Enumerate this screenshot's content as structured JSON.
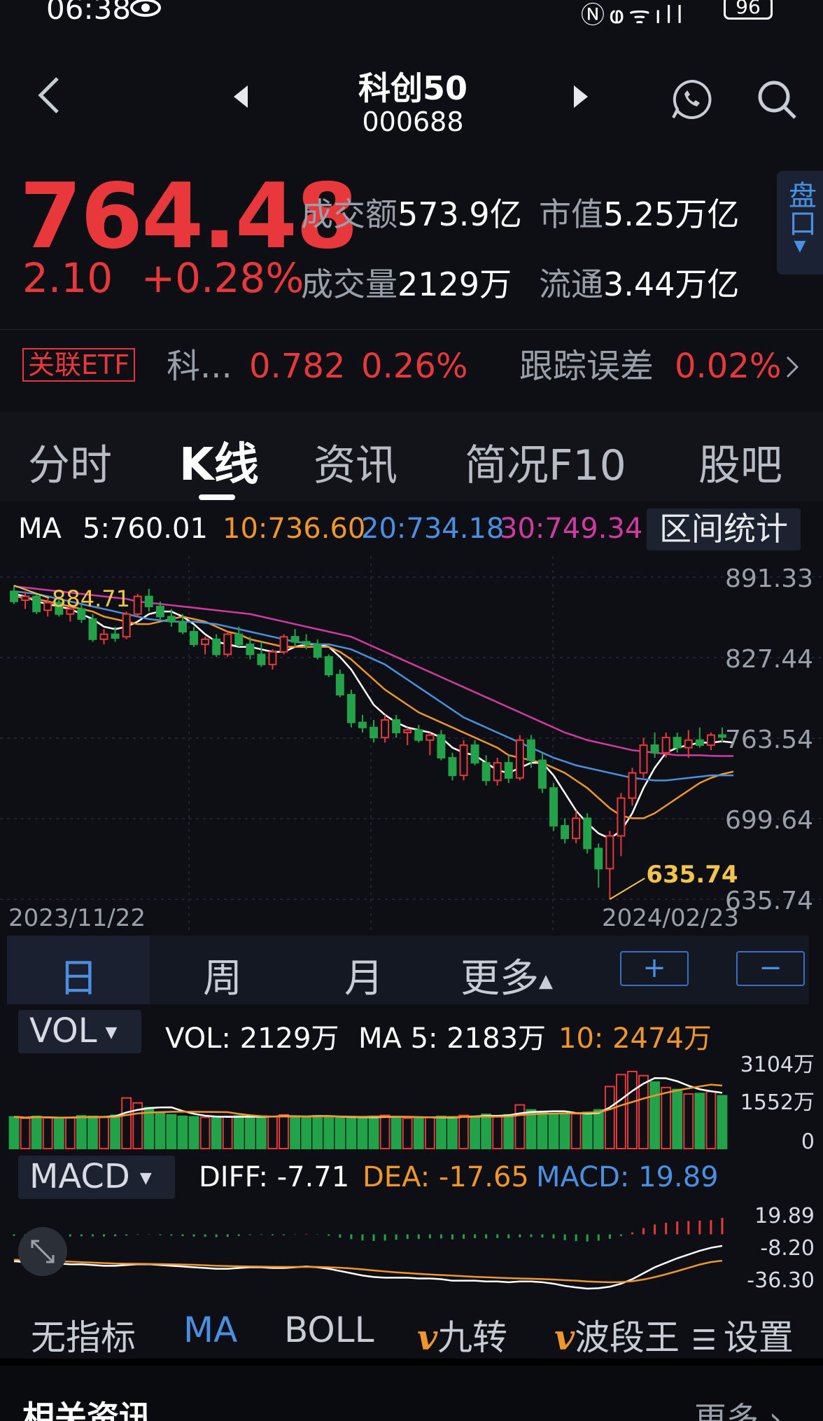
{
  "status_bar": {
    "time": "06:38",
    "battery": "96"
  },
  "header": {
    "name": "科创50",
    "code": "000688"
  },
  "quote": {
    "price": "764.48",
    "change": "2.10",
    "change_pct": "+0.28%",
    "turnover_label": "成交额",
    "turnover_value": "573.9亿",
    "market_cap_label": "市值",
    "market_cap_value": "5.25万亿",
    "volume_label": "成交量",
    "volume_value": "2129万",
    "float_label": "流通",
    "float_value": "3.44万亿",
    "panel_tab": "盘口"
  },
  "etf": {
    "badge": "关联ETF",
    "name": "科...",
    "price": "0.782",
    "pct": "0.26%",
    "tracking_label": "跟踪误差",
    "tracking_value": "0.02%"
  },
  "tabs": [
    "分时",
    "K线",
    "资讯",
    "简况F10",
    "股吧"
  ],
  "active_tab": "K线",
  "ma_header": {
    "label": "MA",
    "ma5": "5:760.01",
    "ma10": "10:736.60",
    "ma20": "20:734.18",
    "ma30": "30:749.34",
    "range_button": "区间统计"
  },
  "kline": {
    "y_ticks": [
      "891.33",
      "827.44",
      "763.54",
      "699.64",
      "635.74"
    ],
    "start_date": "2023/11/22",
    "end_date": "2024/02/23",
    "high_mark": "884.71",
    "low_mark": "635.74"
  },
  "periods": [
    "日",
    "周",
    "月",
    "更多"
  ],
  "zoom": {
    "plus": "+",
    "minus": "−"
  },
  "vol_header": {
    "selector": "VOL",
    "vol": "VOL: 2129万",
    "ma5": "MA 5: 2183万",
    "ma10": "10: 2474万",
    "y_ticks": [
      "3104万",
      "1552万",
      "0"
    ]
  },
  "macd_header": {
    "selector": "MACD",
    "diff": "DIFF: -7.71",
    "dea": "DEA: -17.65",
    "macd": "MACD: 19.89",
    "y_ticks": [
      "19.89",
      "-8.20",
      "-36.30"
    ]
  },
  "indicators": [
    "无指标",
    "MA",
    "BOLL",
    "九转",
    "波段王",
    "设置"
  ],
  "active_indicator": "MA",
  "news": {
    "title": "相关资讯",
    "more": "更多"
  },
  "colors": {
    "up": "#e8383b",
    "down": "#22a34a",
    "ma5": "#ffffff",
    "ma10": "#f0962b",
    "ma20": "#4a90e2",
    "ma30": "#d23aa1",
    "accent": "#4a90e2"
  },
  "chart_data": {
    "type": "candlestick",
    "candles": [
      {
        "o": 880,
        "h": 884.71,
        "l": 870,
        "c": 872
      },
      {
        "o": 873,
        "h": 880,
        "l": 866,
        "c": 876
      },
      {
        "o": 876,
        "h": 878,
        "l": 862,
        "c": 864
      },
      {
        "o": 865,
        "h": 874,
        "l": 860,
        "c": 871
      },
      {
        "o": 871,
        "h": 876,
        "l": 860,
        "c": 862
      },
      {
        "o": 862,
        "h": 868,
        "l": 856,
        "c": 866
      },
      {
        "o": 866,
        "h": 870,
        "l": 855,
        "c": 858
      },
      {
        "o": 858,
        "h": 862,
        "l": 840,
        "c": 842
      },
      {
        "o": 842,
        "h": 850,
        "l": 838,
        "c": 846
      },
      {
        "o": 846,
        "h": 852,
        "l": 840,
        "c": 843
      },
      {
        "o": 844,
        "h": 864,
        "l": 842,
        "c": 862
      },
      {
        "o": 862,
        "h": 878,
        "l": 860,
        "c": 876
      },
      {
        "o": 876,
        "h": 882,
        "l": 864,
        "c": 868
      },
      {
        "o": 868,
        "h": 872,
        "l": 858,
        "c": 860
      },
      {
        "o": 860,
        "h": 866,
        "l": 852,
        "c": 856
      },
      {
        "o": 856,
        "h": 862,
        "l": 846,
        "c": 848
      },
      {
        "o": 848,
        "h": 852,
        "l": 836,
        "c": 838
      },
      {
        "o": 838,
        "h": 844,
        "l": 830,
        "c": 842
      },
      {
        "o": 842,
        "h": 846,
        "l": 828,
        "c": 830
      },
      {
        "o": 830,
        "h": 848,
        "l": 828,
        "c": 846
      },
      {
        "o": 846,
        "h": 852,
        "l": 836,
        "c": 838
      },
      {
        "o": 838,
        "h": 844,
        "l": 826,
        "c": 830
      },
      {
        "o": 830,
        "h": 840,
        "l": 820,
        "c": 822
      },
      {
        "o": 822,
        "h": 834,
        "l": 818,
        "c": 832
      },
      {
        "o": 832,
        "h": 846,
        "l": 830,
        "c": 844
      },
      {
        "o": 844,
        "h": 850,
        "l": 836,
        "c": 840
      },
      {
        "o": 840,
        "h": 846,
        "l": 834,
        "c": 838
      },
      {
        "o": 838,
        "h": 842,
        "l": 826,
        "c": 828
      },
      {
        "o": 828,
        "h": 830,
        "l": 812,
        "c": 814
      },
      {
        "o": 814,
        "h": 818,
        "l": 796,
        "c": 798
      },
      {
        "o": 798,
        "h": 802,
        "l": 772,
        "c": 776
      },
      {
        "o": 776,
        "h": 782,
        "l": 768,
        "c": 772
      },
      {
        "o": 772,
        "h": 778,
        "l": 760,
        "c": 764
      },
      {
        "o": 764,
        "h": 782,
        "l": 760,
        "c": 778
      },
      {
        "o": 778,
        "h": 782,
        "l": 764,
        "c": 768
      },
      {
        "o": 768,
        "h": 772,
        "l": 758,
        "c": 770
      },
      {
        "o": 770,
        "h": 774,
        "l": 760,
        "c": 762
      },
      {
        "o": 762,
        "h": 768,
        "l": 750,
        "c": 766
      },
      {
        "o": 766,
        "h": 770,
        "l": 746,
        "c": 748
      },
      {
        "o": 748,
        "h": 752,
        "l": 730,
        "c": 734
      },
      {
        "o": 734,
        "h": 762,
        "l": 730,
        "c": 758
      },
      {
        "o": 758,
        "h": 762,
        "l": 742,
        "c": 744
      },
      {
        "o": 744,
        "h": 750,
        "l": 726,
        "c": 730
      },
      {
        "o": 730,
        "h": 748,
        "l": 726,
        "c": 744
      },
      {
        "o": 744,
        "h": 750,
        "l": 728,
        "c": 732
      },
      {
        "o": 732,
        "h": 766,
        "l": 730,
        "c": 762
      },
      {
        "o": 762,
        "h": 766,
        "l": 740,
        "c": 746
      },
      {
        "o": 746,
        "h": 752,
        "l": 720,
        "c": 724
      },
      {
        "o": 724,
        "h": 728,
        "l": 690,
        "c": 694
      },
      {
        "o": 694,
        "h": 700,
        "l": 680,
        "c": 684
      },
      {
        "o": 684,
        "h": 706,
        "l": 680,
        "c": 700
      },
      {
        "o": 700,
        "h": 704,
        "l": 672,
        "c": 676
      },
      {
        "o": 676,
        "h": 680,
        "l": 645,
        "c": 660
      },
      {
        "o": 660,
        "h": 690,
        "l": 635.74,
        "c": 686
      },
      {
        "o": 686,
        "h": 720,
        "l": 670,
        "c": 716
      },
      {
        "o": 716,
        "h": 740,
        "l": 710,
        "c": 736
      },
      {
        "o": 736,
        "h": 764,
        "l": 732,
        "c": 758
      },
      {
        "o": 758,
        "h": 768,
        "l": 748,
        "c": 752
      },
      {
        "o": 752,
        "h": 768,
        "l": 748,
        "c": 764
      },
      {
        "o": 764,
        "h": 768,
        "l": 752,
        "c": 756
      },
      {
        "o": 756,
        "h": 770,
        "l": 748,
        "c": 762
      },
      {
        "o": 762,
        "h": 772,
        "l": 756,
        "c": 758
      },
      {
        "o": 758,
        "h": 768,
        "l": 754,
        "c": 766
      },
      {
        "o": 766,
        "h": 772,
        "l": 760,
        "c": 764.48
      }
    ],
    "ylim": [
      635.74,
      891.33
    ],
    "ma": [
      {
        "name": "MA5",
        "values": [
          878,
          876,
          872,
          870,
          868,
          866,
          862,
          858,
          852,
          850,
          852,
          856,
          862,
          864,
          864,
          860,
          854,
          846,
          840,
          838,
          836,
          836,
          834,
          832,
          832,
          836,
          838,
          838,
          836,
          828,
          818,
          804,
          790,
          782,
          776,
          772,
          770,
          768,
          764,
          756,
          752,
          750,
          744,
          738,
          736,
          740,
          744,
          744,
          734,
          720,
          706,
          696,
          688,
          684,
          690,
          704,
          724,
          740,
          752,
          756,
          758,
          760,
          760,
          761,
          760
        ]
      },
      {
        "name": "MA10",
        "values": [
          876,
          875,
          874,
          872,
          870,
          868,
          866,
          864,
          860,
          858,
          856,
          854,
          854,
          856,
          858,
          860,
          858,
          856,
          852,
          848,
          846,
          842,
          840,
          838,
          836,
          836,
          836,
          836,
          836,
          832,
          826,
          818,
          810,
          802,
          796,
          790,
          784,
          780,
          776,
          772,
          768,
          764,
          760,
          756,
          750,
          748,
          746,
          744,
          740,
          736,
          730,
          724,
          716,
          708,
          702,
          700,
          700,
          704,
          710,
          716,
          722,
          728,
          732,
          735,
          737
        ]
      },
      {
        "name": "MA20",
        "values": [
          880,
          879,
          878,
          876,
          874,
          872,
          870,
          868,
          866,
          864,
          862,
          860,
          858,
          857,
          856,
          856,
          856,
          855,
          854,
          852,
          850,
          848,
          846,
          844,
          842,
          840,
          839,
          838,
          838,
          836,
          834,
          830,
          826,
          822,
          816,
          810,
          804,
          798,
          792,
          786,
          780,
          776,
          772,
          768,
          764,
          760,
          756,
          752,
          748,
          745,
          742,
          740,
          738,
          736,
          734,
          732,
          731,
          730,
          730,
          731,
          732,
          733,
          734,
          734,
          734
        ]
      },
      {
        "name": "MA30",
        "values": [
          884,
          883,
          882,
          881,
          880,
          879,
          878,
          877,
          876,
          875,
          874,
          872,
          871,
          870,
          869,
          868,
          867,
          866,
          865,
          864,
          863,
          862,
          860,
          858,
          856,
          854,
          852,
          850,
          848,
          846,
          844,
          840,
          836,
          832,
          828,
          824,
          820,
          816,
          812,
          808,
          804,
          800,
          796,
          792,
          788,
          784,
          780,
          776,
          772,
          768,
          765,
          762,
          760,
          758,
          756,
          754,
          753,
          752,
          751,
          750,
          750,
          750,
          749.5,
          749.4,
          749.34
        ]
      }
    ],
    "volume_y_max": 3104,
    "volume": [
      1280,
      1220,
      1300,
      1240,
      1210,
      1260,
      1320,
      1300,
      1280,
      1340,
      2040,
      1840,
      1650,
      1420,
      1360,
      1300,
      1280,
      1260,
      1240,
      1300,
      1320,
      1300,
      1260,
      1280,
      1360,
      1300,
      1280,
      1320,
      1300,
      1240,
      1220,
      1260,
      1300,
      1340,
      1280,
      1220,
      1200,
      1260,
      1300,
      1280,
      1340,
      1300,
      1380,
      1300,
      1360,
      1760,
      1560,
      1460,
      1380,
      1360,
      1400,
      1460,
      1560,
      2500,
      2980,
      3104,
      2940,
      2680,
      2460,
      2380,
      2200,
      2220,
      2300,
      2129
    ],
    "macd_ylim": [
      -36.3,
      19.89
    ],
    "macd_diff": [
      -18,
      -18.5,
      -19,
      -19,
      -19.5,
      -20,
      -20,
      -20.5,
      -21,
      -21,
      -20.5,
      -20,
      -20,
      -20.5,
      -21,
      -21.5,
      -22,
      -22.5,
      -23,
      -23,
      -22.5,
      -22,
      -22,
      -22.5,
      -22.5,
      -22,
      -21.5,
      -22,
      -23,
      -24.5,
      -26,
      -27.5,
      -28.5,
      -29,
      -29,
      -29,
      -29.5,
      -29.5,
      -30,
      -31,
      -31,
      -31,
      -31.5,
      -31.5,
      -32,
      -31.5,
      -31.5,
      -32,
      -33,
      -34.5,
      -35.5,
      -36.3,
      -36,
      -35,
      -33,
      -30,
      -26,
      -22,
      -19,
      -16,
      -13.5,
      -11,
      -9,
      -7.71
    ],
    "macd_dea": [
      -17,
      -17.2,
      -17.5,
      -17.8,
      -18,
      -18.3,
      -18.6,
      -18.9,
      -19.2,
      -19.5,
      -19.6,
      -19.7,
      -19.8,
      -19.9,
      -20,
      -20.2,
      -20.4,
      -20.7,
      -21,
      -21.2,
      -21.4,
      -21.5,
      -21.6,
      -21.7,
      -21.8,
      -21.8,
      -21.8,
      -21.8,
      -22,
      -22.3,
      -22.8,
      -23.4,
      -24.1,
      -24.8,
      -25.4,
      -25.9,
      -26.4,
      -26.8,
      -27.2,
      -27.6,
      -28,
      -28.4,
      -28.7,
      -29,
      -29.3,
      -29.5,
      -29.7,
      -29.9,
      -30.2,
      -30.6,
      -31,
      -31.5,
      -31.8,
      -32,
      -31.9,
      -31.3,
      -30.2,
      -28.6,
      -26.7,
      -24.6,
      -22.4,
      -20.2,
      -18.5,
      -17.65
    ],
    "macd_hist": [
      -1,
      -1.2,
      -1.4,
      -1.2,
      -1.3,
      -1.4,
      -1.3,
      -1.4,
      -1.5,
      -1.3,
      -0.9,
      -0.3,
      -0.2,
      -0.6,
      -0.9,
      -1.2,
      -1.5,
      -1.6,
      -1.9,
      -1.7,
      -1.1,
      -0.5,
      -0.4,
      -0.7,
      -0.6,
      -0.2,
      0.3,
      -0.2,
      -1,
      -2.2,
      -3.2,
      -4.1,
      -4.4,
      -4.2,
      -3.6,
      -3.1,
      -3.1,
      -2.7,
      -2.8,
      -3.4,
      -3,
      -2.6,
      -2.8,
      -2.5,
      -2.7,
      -2,
      -1.8,
      -2.1,
      -2.8,
      -3.9,
      -4.5,
      -4.8,
      -4.2,
      -3,
      -1.1,
      1.3,
      4.2,
      6.6,
      7.7,
      8.6,
      8.9,
      9.2,
      9.5,
      19.89
    ]
  }
}
